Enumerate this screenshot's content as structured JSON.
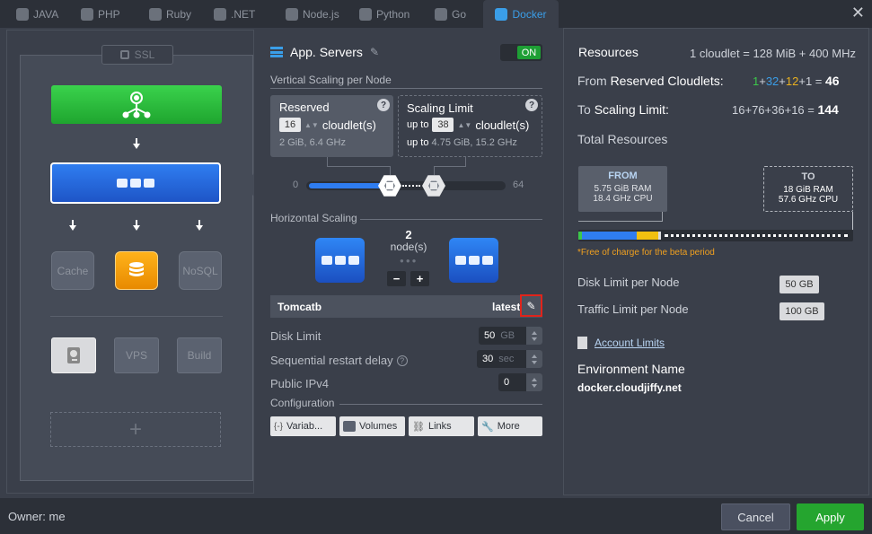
{
  "tabs": [
    {
      "label": "JAVA",
      "icon": "java-icon"
    },
    {
      "label": "PHP",
      "icon": "php-icon"
    },
    {
      "label": "Ruby",
      "icon": "ruby-icon"
    },
    {
      "label": ".NET",
      "icon": "dotnet-icon"
    },
    {
      "label": "Node.js",
      "icon": "nodejs-icon"
    },
    {
      "label": "Python",
      "icon": "python-icon"
    },
    {
      "label": "Go",
      "icon": "go-icon"
    },
    {
      "label": "Docker",
      "icon": "docker-icon",
      "active": true
    }
  ],
  "topology": {
    "ssl_label": "SSL",
    "db_nodes": [
      "Cache",
      "NoSQL"
    ],
    "extra_nodes": [
      "VPS",
      "Build"
    ],
    "add_symbol": "+"
  },
  "config": {
    "title": "App. Servers",
    "toggle": "ON",
    "vertical_title": "Vertical Scaling per Node",
    "reserved": {
      "title": "Reserved",
      "value": "16",
      "unit": "cloudlet(s)",
      "info": "2 GiB, 6.4 GHz"
    },
    "limit": {
      "title": "Scaling Limit",
      "prefix": "up to",
      "value": "38",
      "unit": "cloudlet(s)",
      "info_prefix": "up to",
      "info": "4.75 GiB, 15.2 GHz"
    },
    "slider_min": "0",
    "slider_max": "64",
    "horizontal_title": "Horizontal Scaling",
    "node_count": "2",
    "node_label": "node(s)",
    "minus": "−",
    "plus": "+",
    "stack_name": "Tomcatb",
    "stack_tag": "latest",
    "disk_limit": {
      "label": "Disk Limit",
      "value": "50",
      "unit": "GB"
    },
    "restart_delay": {
      "label": "Sequential restart delay",
      "value": "30",
      "unit": "sec"
    },
    "public_ipv4": {
      "label": "Public IPv4",
      "value": "0"
    },
    "config_title": "Configuration",
    "config_buttons": [
      {
        "label": "Variab...",
        "icon": "variables-icon"
      },
      {
        "label": "Volumes",
        "icon": "volumes-icon"
      },
      {
        "label": "Links",
        "icon": "links-icon"
      },
      {
        "label": "More",
        "icon": "wrench-icon"
      }
    ]
  },
  "resources": {
    "title": "Resources",
    "cloudlet_def": "1 cloudlet = 128 MiB + 400 MHz",
    "from_label_a": "From",
    "from_label_b": "Reserved Cloudlets:",
    "from_terms": [
      "1",
      "32",
      "12",
      "1"
    ],
    "from_total": "46",
    "to_label_a": "To",
    "to_label_b": "Scaling Limit:",
    "to_terms": [
      "16",
      "76",
      "36",
      "16"
    ],
    "to_total": "144",
    "total_title": "Total Resources",
    "from_box": {
      "title": "FROM",
      "ram": "5.75 GiB RAM",
      "cpu": "18.4 GHz CPU"
    },
    "to_box": {
      "title": "TO",
      "ram": "18 GiB RAM",
      "cpu": "57.6 GHz CPU"
    },
    "free_note": "*Free of charge for the beta period",
    "disk_limit_label": "Disk Limit per Node",
    "disk_limit_value": "50 GB",
    "traffic_label": "Traffic Limit per Node",
    "traffic_value": "100 GB",
    "account_limits": "Account Limits",
    "env_name_label": "Environment Name",
    "env_name": "docker.cloudjiffy.net"
  },
  "footer": {
    "owner": "Owner: me",
    "cancel": "Cancel",
    "apply": "Apply"
  }
}
